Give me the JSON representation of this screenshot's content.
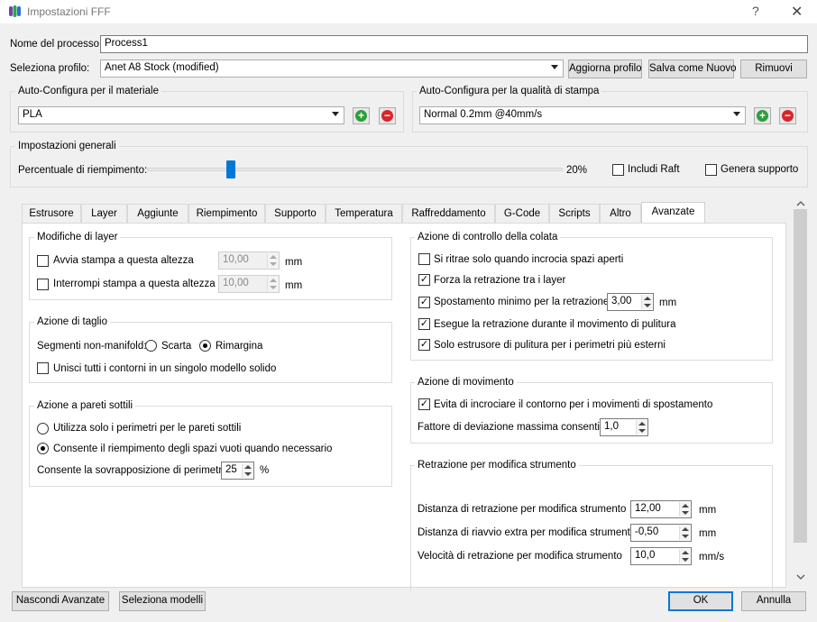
{
  "window": {
    "title": "Impostazioni FFF",
    "help": "?",
    "close": "✕"
  },
  "process": {
    "label": "Nome del processo:",
    "value": "Process1"
  },
  "profile": {
    "label": "Seleziona profilo:",
    "value": "Anet A8 Stock (modified)",
    "update_btn": "Aggiorna profilo",
    "save_btn": "Salva come Nuovo",
    "remove_btn": "Rimuovi"
  },
  "material": {
    "title": "Auto-Configura per il materiale",
    "value": "PLA"
  },
  "quality": {
    "title": "Auto-Configura per la qualità di stampa",
    "value": "Normal 0.2mm @40mm/s"
  },
  "general": {
    "title": "Impostazioni generali",
    "infill_label": "Percentuale di riempimento:",
    "infill_value": "20%",
    "infill_fraction": 0.2,
    "raft_label": "Includi Raft",
    "raft_checked": false,
    "support_label": "Genera supporto",
    "support_checked": false
  },
  "tabs": [
    "Estrusore",
    "Layer",
    "Aggiunte",
    "Riempimento",
    "Supporto",
    "Temperatura",
    "Raffreddamento",
    "G-Code",
    "Scripts",
    "Altro",
    "Avanzate"
  ],
  "active_tab": "Avanzate",
  "layer_changes": {
    "title": "Modifiche di layer",
    "start_label": "Avvia stampa a questa altezza",
    "start_value": "10,00",
    "stop_label": "Interrompi stampa a questa altezza",
    "stop_value": "10,00",
    "unit": "mm"
  },
  "slicing": {
    "title": "Azione di taglio",
    "nonmanifold_label": "Segmenti non-manifold:",
    "discard_label": "Scarta",
    "heal_label": "Rimargina",
    "merge_label": "Unisci tutti i contorni in un singolo modello solido"
  },
  "thin_walls": {
    "title": "Azione a pareti sottili",
    "perimeters_only_label": "Utilizza solo i perimetri per le pareti sottili",
    "allow_gap_fill_label": "Consente il riempimento degli spazi vuoti quando necessario",
    "overlap_label": "Consente la sovrapposizione di perimetro",
    "overlap_value": "25",
    "overlap_unit": "%"
  },
  "ooze": {
    "title": "Azione di controllo della colata",
    "only_retract_label": "Si ritrae solo quando incrocia spazi aperti",
    "force_retract_label": "Forza la retrazione tra i layer",
    "min_travel_label": "Spostamento minimo per la retrazione",
    "min_travel_value": "3,00",
    "min_travel_unit": "mm",
    "wipe_retract_label": "Esegue la retrazione durante il movimento di pulitura",
    "wipe_outer_label": "Solo estrusore di pulitura per i perimetri più esterni"
  },
  "movement": {
    "title": "Azione di movimento",
    "avoid_label": "Evita di incrociare il contorno per i movimenti di spostamento",
    "deviation_label": "Fattore di deviazione massima consentita",
    "deviation_value": "1,0"
  },
  "toolchange": {
    "title": "Retrazione per modifica strumento",
    "distance_label": "Distanza di retrazione per modifica strumento",
    "distance_value": "12,00",
    "distance_unit": "mm",
    "extra_label": "Distanza di riavvio extra per modifica strumento",
    "extra_value": "-0,50",
    "extra_unit": "mm",
    "speed_label": "Velocità di retrazione per modifica strumento",
    "speed_value": "10,0",
    "speed_unit": "mm/s"
  },
  "footer": {
    "hide_advanced": "Nascondi Avanzate",
    "select_models": "Seleziona modelli",
    "ok": "OK",
    "cancel": "Annulla"
  },
  "colors": {
    "accent": "#0078d7",
    "add_green": "#2e9e3a",
    "remove_red": "#d7262b"
  }
}
